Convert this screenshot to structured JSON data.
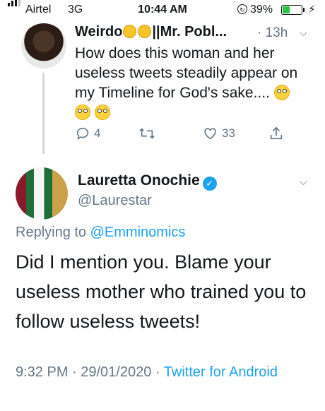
{
  "status_bar": {
    "carrier": "Airtel",
    "network": "3G",
    "time": "10:44 AM",
    "battery_percent": "39%",
    "battery_level": 0.39
  },
  "colors": {
    "link": "#1da1f2",
    "muted": "#657786",
    "verified": "#1da1f2"
  },
  "tweet1": {
    "name": "Weirdo",
    "name_suffix": "||Mr. Pobl...",
    "separator": "·",
    "time_ago": "13h",
    "text": "How does this woman and her useless tweets steadily appear on my Timeline for God's sake....",
    "counts": {
      "replies": "4",
      "likes": "33"
    }
  },
  "tweet2": {
    "name": "Lauretta Onochie",
    "handle": "@Laurestar",
    "replying_prefix": "Replying to",
    "replying_handle": "@Emminomics",
    "text": "Did I mention you. Blame your useless mother who trained you to follow useless tweets!",
    "timestamp": "9:32 PM · 29/01/2020 ·",
    "source": "Twitter for Android"
  },
  "icons": {
    "reply": "reply-icon",
    "retweet": "retweet-icon",
    "like": "heart-icon",
    "share": "share-icon",
    "verified": "verified-badge-icon"
  }
}
